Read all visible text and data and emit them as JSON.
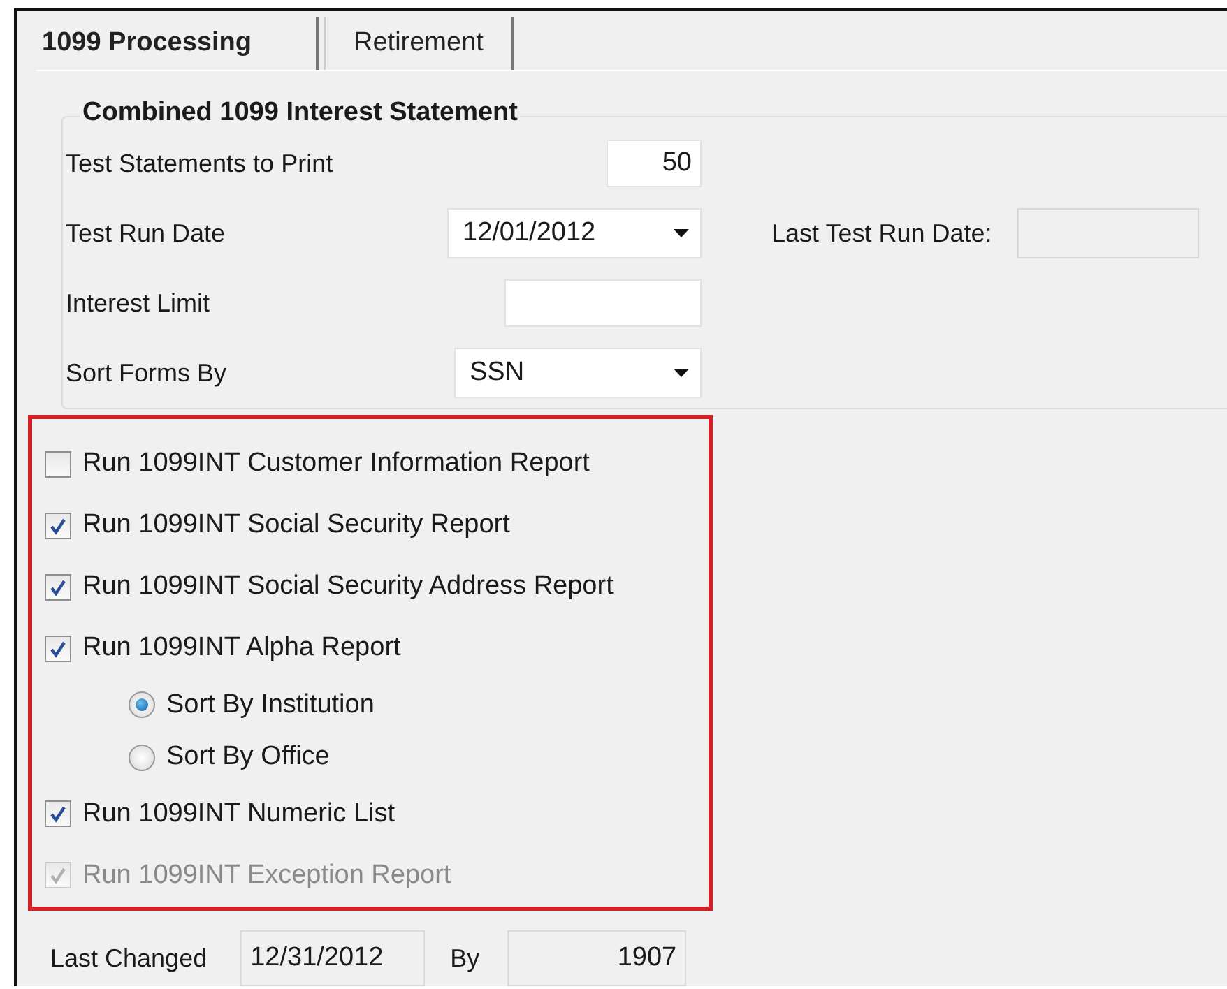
{
  "tabs": [
    {
      "label": "1099 Processing",
      "selected": true
    },
    {
      "label": "Retirement",
      "selected": false
    }
  ],
  "group": {
    "title": "Combined 1099 Interest Statement",
    "fields": [
      {
        "label": "Test Statements to Print",
        "kind": "number",
        "value": "50"
      },
      {
        "label": "Test Run Date",
        "kind": "date",
        "value": "12/01/2012",
        "side_label": "Last Test Run Date:"
      },
      {
        "label": "Interest Limit",
        "kind": "text"
      },
      {
        "label": "Sort Forms By",
        "kind": "select",
        "value": "SSN"
      }
    ]
  },
  "options": [
    {
      "label": "Run 1099INT Customer Information Report",
      "checked": false,
      "disabled": false
    },
    {
      "label": "Run 1099INT Social Security Report",
      "checked": true,
      "disabled": false
    },
    {
      "label": "Run 1099INT Social Security Address Report",
      "checked": true,
      "disabled": false
    },
    {
      "label": "Run 1099INT Alpha Report",
      "checked": true,
      "disabled": false,
      "children": [
        {
          "label": "Sort By Institution",
          "selected": true
        },
        {
          "label": "Sort By Office",
          "selected": false
        }
      ]
    },
    {
      "label": "Run 1099INT Numeric List",
      "checked": true,
      "disabled": false
    },
    {
      "label": "Run 1099INT Exception Report",
      "checked": true,
      "disabled": true
    }
  ],
  "footer": {
    "last_changed_label": "Last Changed",
    "last_changed": "12/31/2012",
    "by_label": "By",
    "by": "1907"
  }
}
